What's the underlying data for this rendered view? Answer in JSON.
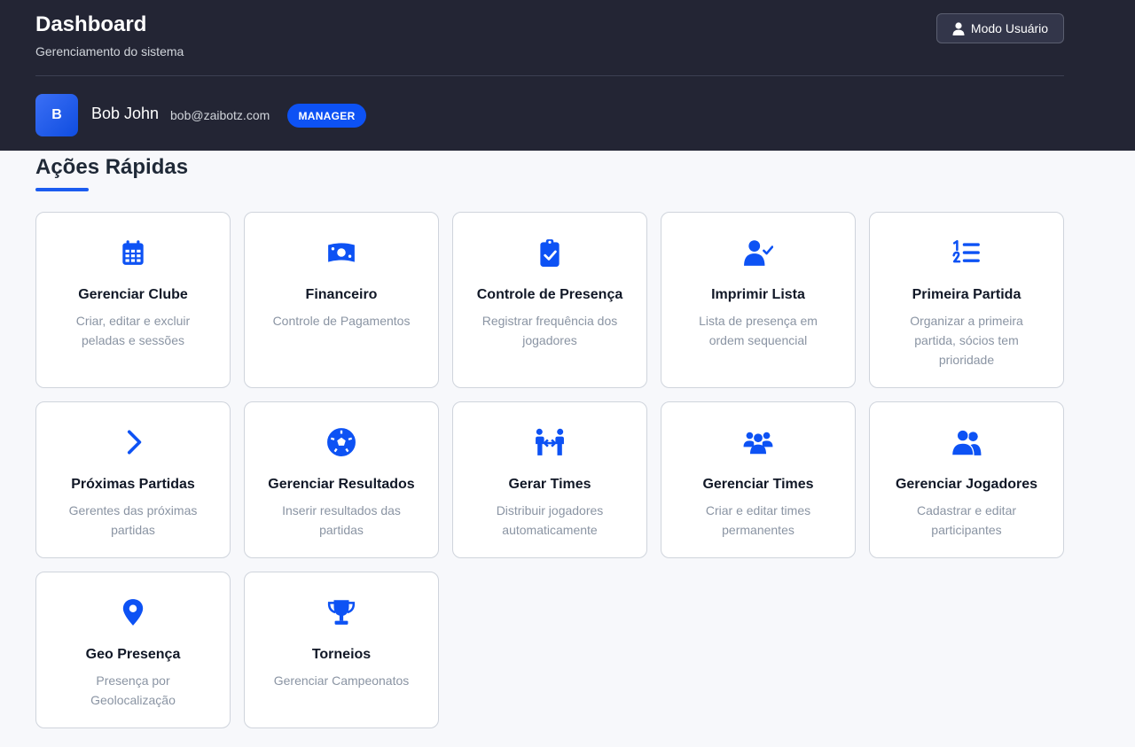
{
  "header": {
    "title": "Dashboard",
    "subtitle": "Gerenciamento do sistema",
    "mode_button": "Modo Usuário"
  },
  "user": {
    "initial": "B",
    "name": "Bob John",
    "email": "bob@zaibotz.com",
    "role": "MANAGER"
  },
  "section": {
    "title": "Ações Rápidas"
  },
  "colors": {
    "accent": "#0d52f4",
    "header_bg": "#232534",
    "icon": "#0d52f4"
  },
  "cards": [
    {
      "icon": "calendar-icon",
      "title": "Gerenciar Clube",
      "desc": "Criar, editar e excluir peladas e sessões"
    },
    {
      "icon": "money-icon",
      "title": "Financeiro",
      "desc": "Controle de Pagamentos"
    },
    {
      "icon": "clipboard-check-icon",
      "title": "Controle de Presença",
      "desc": "Registrar frequência dos jogadores"
    },
    {
      "icon": "user-check-icon",
      "title": "Imprimir Lista",
      "desc": "Lista de presença em ordem sequencial"
    },
    {
      "icon": "list-ol-icon",
      "title": "Primeira Partida",
      "desc": "Organizar a primeira partida, sócios tem prioridade"
    },
    {
      "icon": "chevron-right-icon",
      "title": "Próximas Partidas",
      "desc": "Gerentes das próximas partidas"
    },
    {
      "icon": "soccer-ball-icon",
      "title": "Gerenciar Resultados",
      "desc": "Inserir resultados das partidas"
    },
    {
      "icon": "people-arrows-icon",
      "title": "Gerar Times",
      "desc": "Distribuir jogadores automaticamente"
    },
    {
      "icon": "users-group-icon",
      "title": "Gerenciar Times",
      "desc": "Criar e editar times permanentes"
    },
    {
      "icon": "user-friends-icon",
      "title": "Gerenciar Jogadores",
      "desc": "Cadastrar e editar participantes"
    },
    {
      "icon": "map-pin-icon",
      "title": "Geo Presença",
      "desc": "Presença por Geolocalização"
    },
    {
      "icon": "trophy-icon",
      "title": "Torneios",
      "desc": "Gerenciar Campeonatos"
    }
  ]
}
